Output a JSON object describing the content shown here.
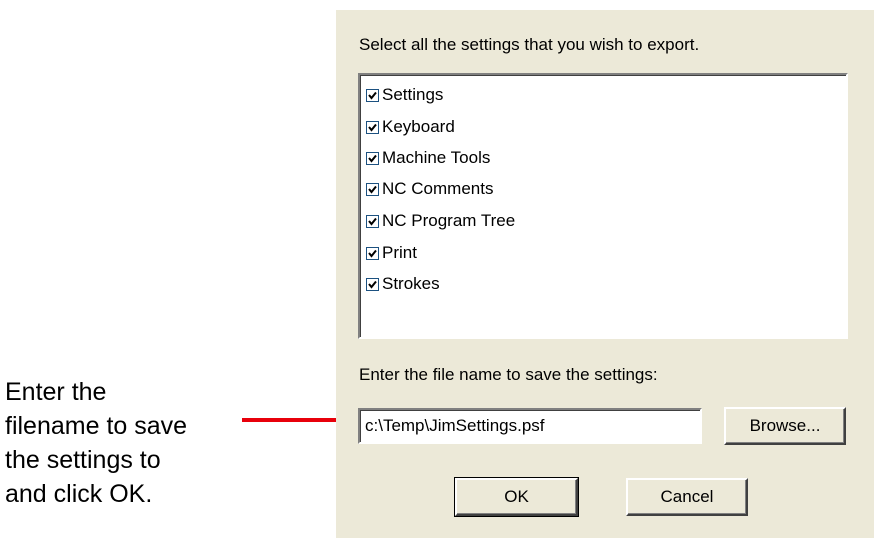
{
  "dialog": {
    "instruction": "Select all the settings that you wish to export.",
    "items": [
      {
        "label": "Settings",
        "checked": true
      },
      {
        "label": "Keyboard",
        "checked": true
      },
      {
        "label": "Machine Tools",
        "checked": true
      },
      {
        "label": "NC Comments",
        "checked": true
      },
      {
        "label": "NC Program Tree",
        "checked": true
      },
      {
        "label": "Print",
        "checked": true
      },
      {
        "label": "Strokes",
        "checked": true
      }
    ],
    "filename_label": "Enter the file name to save the settings:",
    "filename_value": "c:\\Temp\\JimSettings.psf",
    "browse_label": "Browse...",
    "ok_label": "OK",
    "cancel_label": "Cancel"
  },
  "annotation": {
    "lines": [
      "Enter the",
      "filename to save",
      "the settings to",
      "and click OK."
    ],
    "arrow_color": "#E8000B"
  },
  "colors": {
    "dialog_bg": "#ECE9D8",
    "checkbox_border": "#1C5180"
  }
}
